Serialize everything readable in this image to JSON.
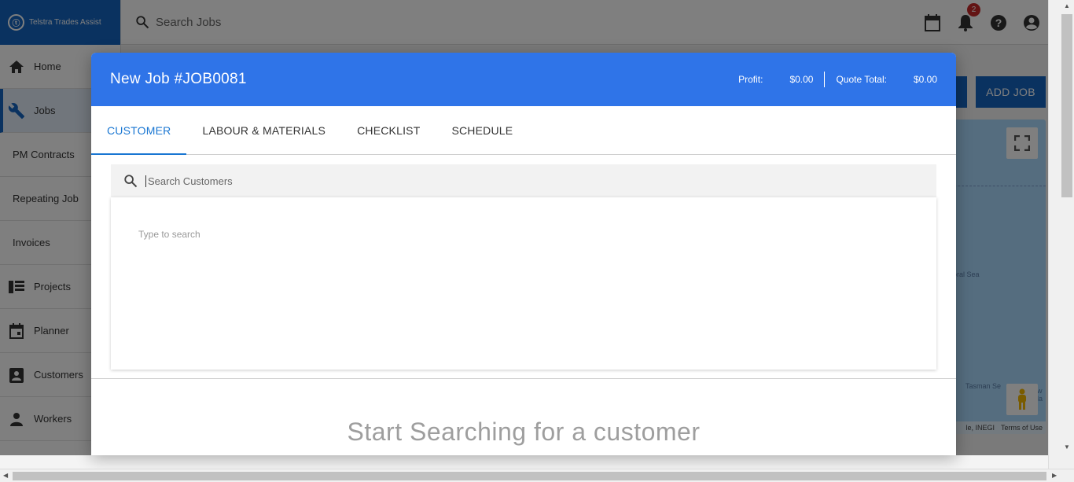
{
  "app": {
    "brand": "Telstra Trades Assist",
    "search_placeholder": "Search Jobs",
    "notification_count": "2",
    "add_job_label": "ADD JOB"
  },
  "sidebar": {
    "items": [
      {
        "label": "Home",
        "icon": "home-icon"
      },
      {
        "label": "Jobs",
        "icon": "wrench-icon"
      },
      {
        "label": "PM Contracts"
      },
      {
        "label": "Repeating Job"
      },
      {
        "label": "Invoices"
      },
      {
        "label": "Projects",
        "icon": "projects-icon"
      },
      {
        "label": "Planner",
        "icon": "calendar-icon"
      },
      {
        "label": "Customers",
        "icon": "contact-icon"
      },
      {
        "label": "Workers",
        "icon": "person-icon"
      }
    ]
  },
  "map": {
    "labels": [
      "oral Sea",
      "Tasman Se",
      "ew",
      "ala"
    ],
    "footer_attribution": "le, INEGI",
    "footer_terms": "Terms of Use"
  },
  "modal": {
    "title": "New Job #JOB0081",
    "profit_label": "Profit:",
    "profit_value": "$0.00",
    "quote_total_label": "Quote Total:",
    "quote_total_value": "$0.00",
    "tabs": [
      {
        "label": "CUSTOMER",
        "active": true
      },
      {
        "label": "LABOUR & MATERIALS",
        "active": false
      },
      {
        "label": "CHECKLIST",
        "active": false
      },
      {
        "label": "SCHEDULE",
        "active": false
      }
    ],
    "customer_search_placeholder": "Search Customers",
    "results_hint": "Type to search",
    "empty_prompt": "Start Searching for a customer"
  },
  "colors": {
    "brand_blue": "#1565c0",
    "modal_header": "#2f74e8",
    "tab_active": "#1976d2",
    "badge": "#c62828"
  }
}
